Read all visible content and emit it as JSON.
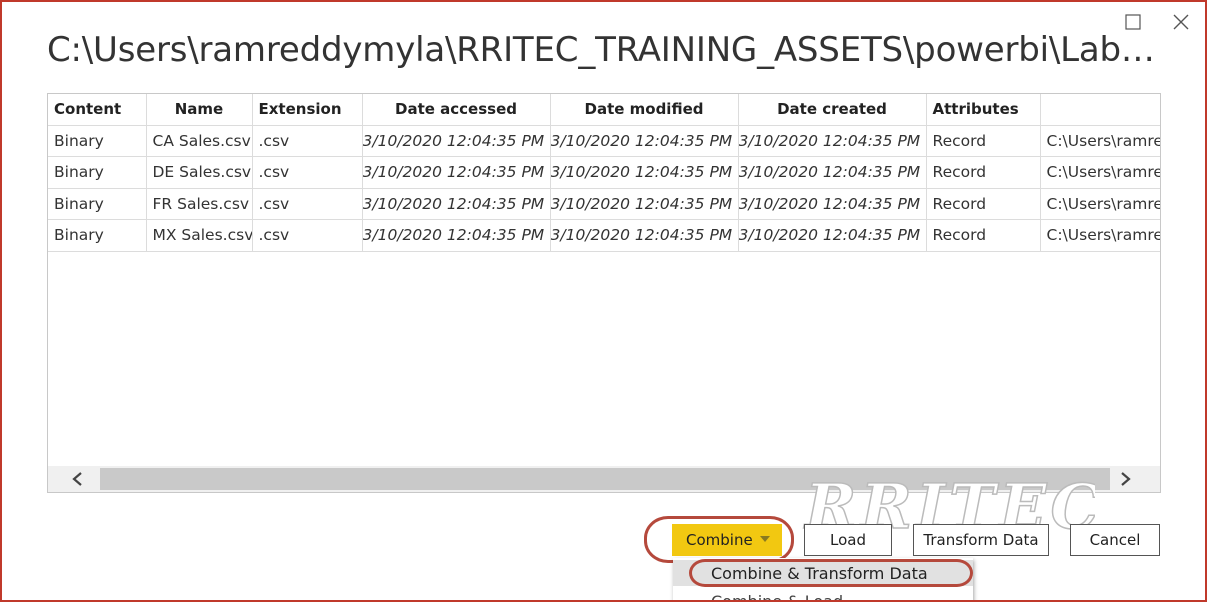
{
  "window": {
    "title": "C:\\Users\\ramreddymyla\\RRITEC_TRAINING_ASSETS\\powerbi\\Labdata\\La..."
  },
  "table": {
    "headers": [
      "Content",
      "Name",
      "Extension",
      "Date accessed",
      "Date modified",
      "Date created",
      "Attributes",
      ""
    ],
    "rows": [
      [
        "Binary",
        "CA Sales.csv",
        ".csv",
        "3/10/2020 12:04:35 PM",
        "3/10/2020 12:04:35 PM",
        "3/10/2020 12:04:35 PM",
        "Record",
        "C:\\Users\\ramre"
      ],
      [
        "Binary",
        "DE Sales.csv",
        ".csv",
        "3/10/2020 12:04:35 PM",
        "3/10/2020 12:04:35 PM",
        "3/10/2020 12:04:35 PM",
        "Record",
        "C:\\Users\\ramre"
      ],
      [
        "Binary",
        "FR Sales.csv",
        ".csv",
        "3/10/2020 12:04:35 PM",
        "3/10/2020 12:04:35 PM",
        "3/10/2020 12:04:35 PM",
        "Record",
        "C:\\Users\\ramre"
      ],
      [
        "Binary",
        "MX Sales.csv",
        ".csv",
        "3/10/2020 12:04:35 PM",
        "3/10/2020 12:04:35 PM",
        "3/10/2020 12:04:35 PM",
        "Record",
        "C:\\Users\\ramre"
      ]
    ]
  },
  "buttons": {
    "combine": "Combine",
    "load": "Load",
    "transform": "Transform Data",
    "cancel": "Cancel"
  },
  "menu": {
    "items": [
      "Combine & Transform Data",
      "Combine & Load"
    ]
  },
  "watermark": "RRITEC",
  "colors": {
    "accent": "#f2c811",
    "annotation": "#b5493c",
    "frame": "#c0392b"
  },
  "icons": [
    "maximize-icon",
    "close-icon",
    "scroll-left-icon",
    "scroll-right-icon",
    "dropdown-caret-icon"
  ]
}
